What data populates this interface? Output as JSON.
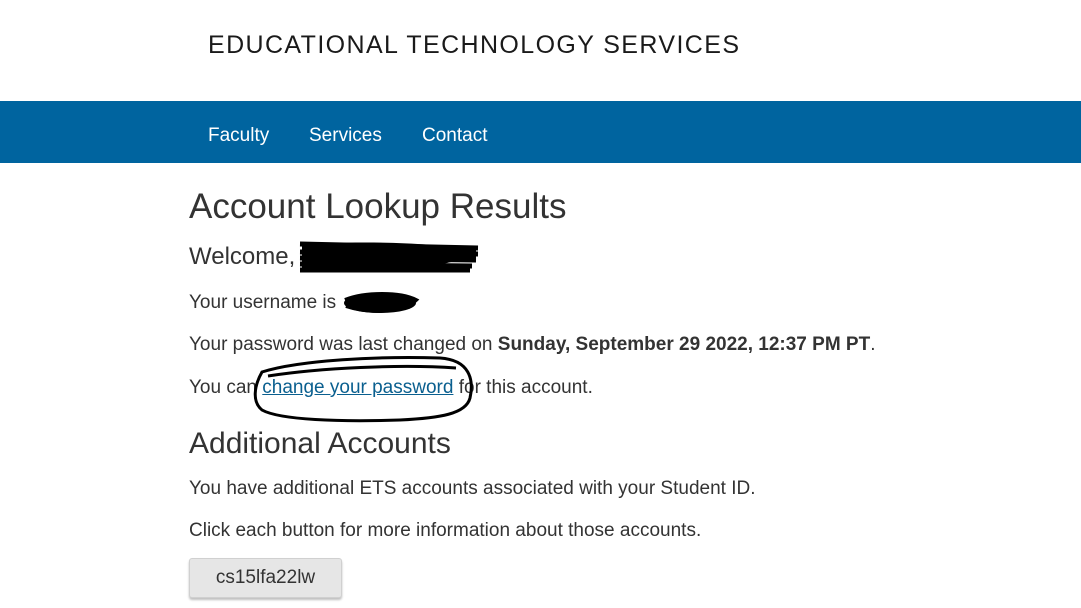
{
  "site": {
    "title": "EDUCATIONAL TECHNOLOGY SERVICES"
  },
  "nav": {
    "items": [
      {
        "label": "Faculty"
      },
      {
        "label": "Services"
      },
      {
        "label": "Contact"
      }
    ]
  },
  "colors": {
    "navbar": "#00649f",
    "link": "#0a5f8f",
    "button_bg": "#e6e6e6",
    "text": "#333333"
  },
  "main": {
    "title": "Account Lookup Results",
    "welcome_prefix": "Welcome,",
    "username_prefix": "Your username is",
    "password_changed_prefix": "Your password was last changed on",
    "password_changed_date": "Sunday, September 29 2022, 12:37 PM PT",
    "password_changed_suffix": ".",
    "change_prefix": "You can",
    "change_link": "change your password",
    "change_suffix": "for this account."
  },
  "additional": {
    "title": "Additional Accounts",
    "line1": "You have additional ETS accounts associated with your Student ID.",
    "line2": "Click each button for more information about those accounts.",
    "accounts": [
      {
        "label": "cs15lfa22lw"
      }
    ]
  }
}
